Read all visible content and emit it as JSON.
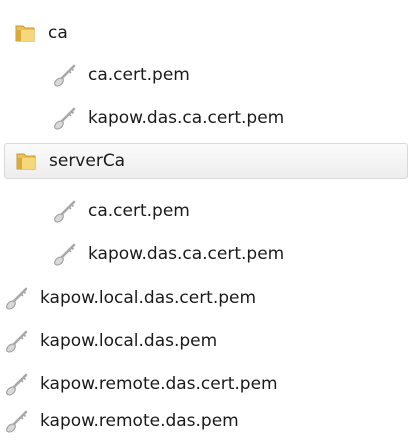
{
  "tree": {
    "items": [
      {
        "label": "ca",
        "icon": "folder-icon",
        "level": 0,
        "selected": false
      },
      {
        "label": "ca.cert.pem",
        "icon": "certificate-key-icon",
        "level": 1,
        "selected": false
      },
      {
        "label": "kapow.das.ca.cert.pem",
        "icon": "certificate-key-icon",
        "level": 1,
        "selected": false
      },
      {
        "label": "serverCa",
        "icon": "folder-icon",
        "level": 0,
        "selected": true
      },
      {
        "label": "ca.cert.pem",
        "icon": "certificate-key-icon",
        "level": 1,
        "selected": false
      },
      {
        "label": "kapow.das.ca.cert.pem",
        "icon": "certificate-key-icon",
        "level": 1,
        "selected": false
      },
      {
        "label": "kapow.local.das.cert.pem",
        "icon": "certificate-key-icon",
        "level": 0,
        "selected": false
      },
      {
        "label": "kapow.local.das.pem",
        "icon": "certificate-key-icon",
        "level": 0,
        "selected": false
      },
      {
        "label": "kapow.remote.das.cert.pem",
        "icon": "certificate-key-icon",
        "level": 0,
        "selected": false
      },
      {
        "label": "kapow.remote.das.pem",
        "icon": "certificate-key-icon",
        "level": 0,
        "selected": false
      }
    ]
  },
  "colors": {
    "text": "#1a1a1a",
    "folder": "#e9c15a",
    "folder_dark": "#c99a2a",
    "key": "#b9b9b9",
    "selected_border": "#d9d9d9"
  }
}
